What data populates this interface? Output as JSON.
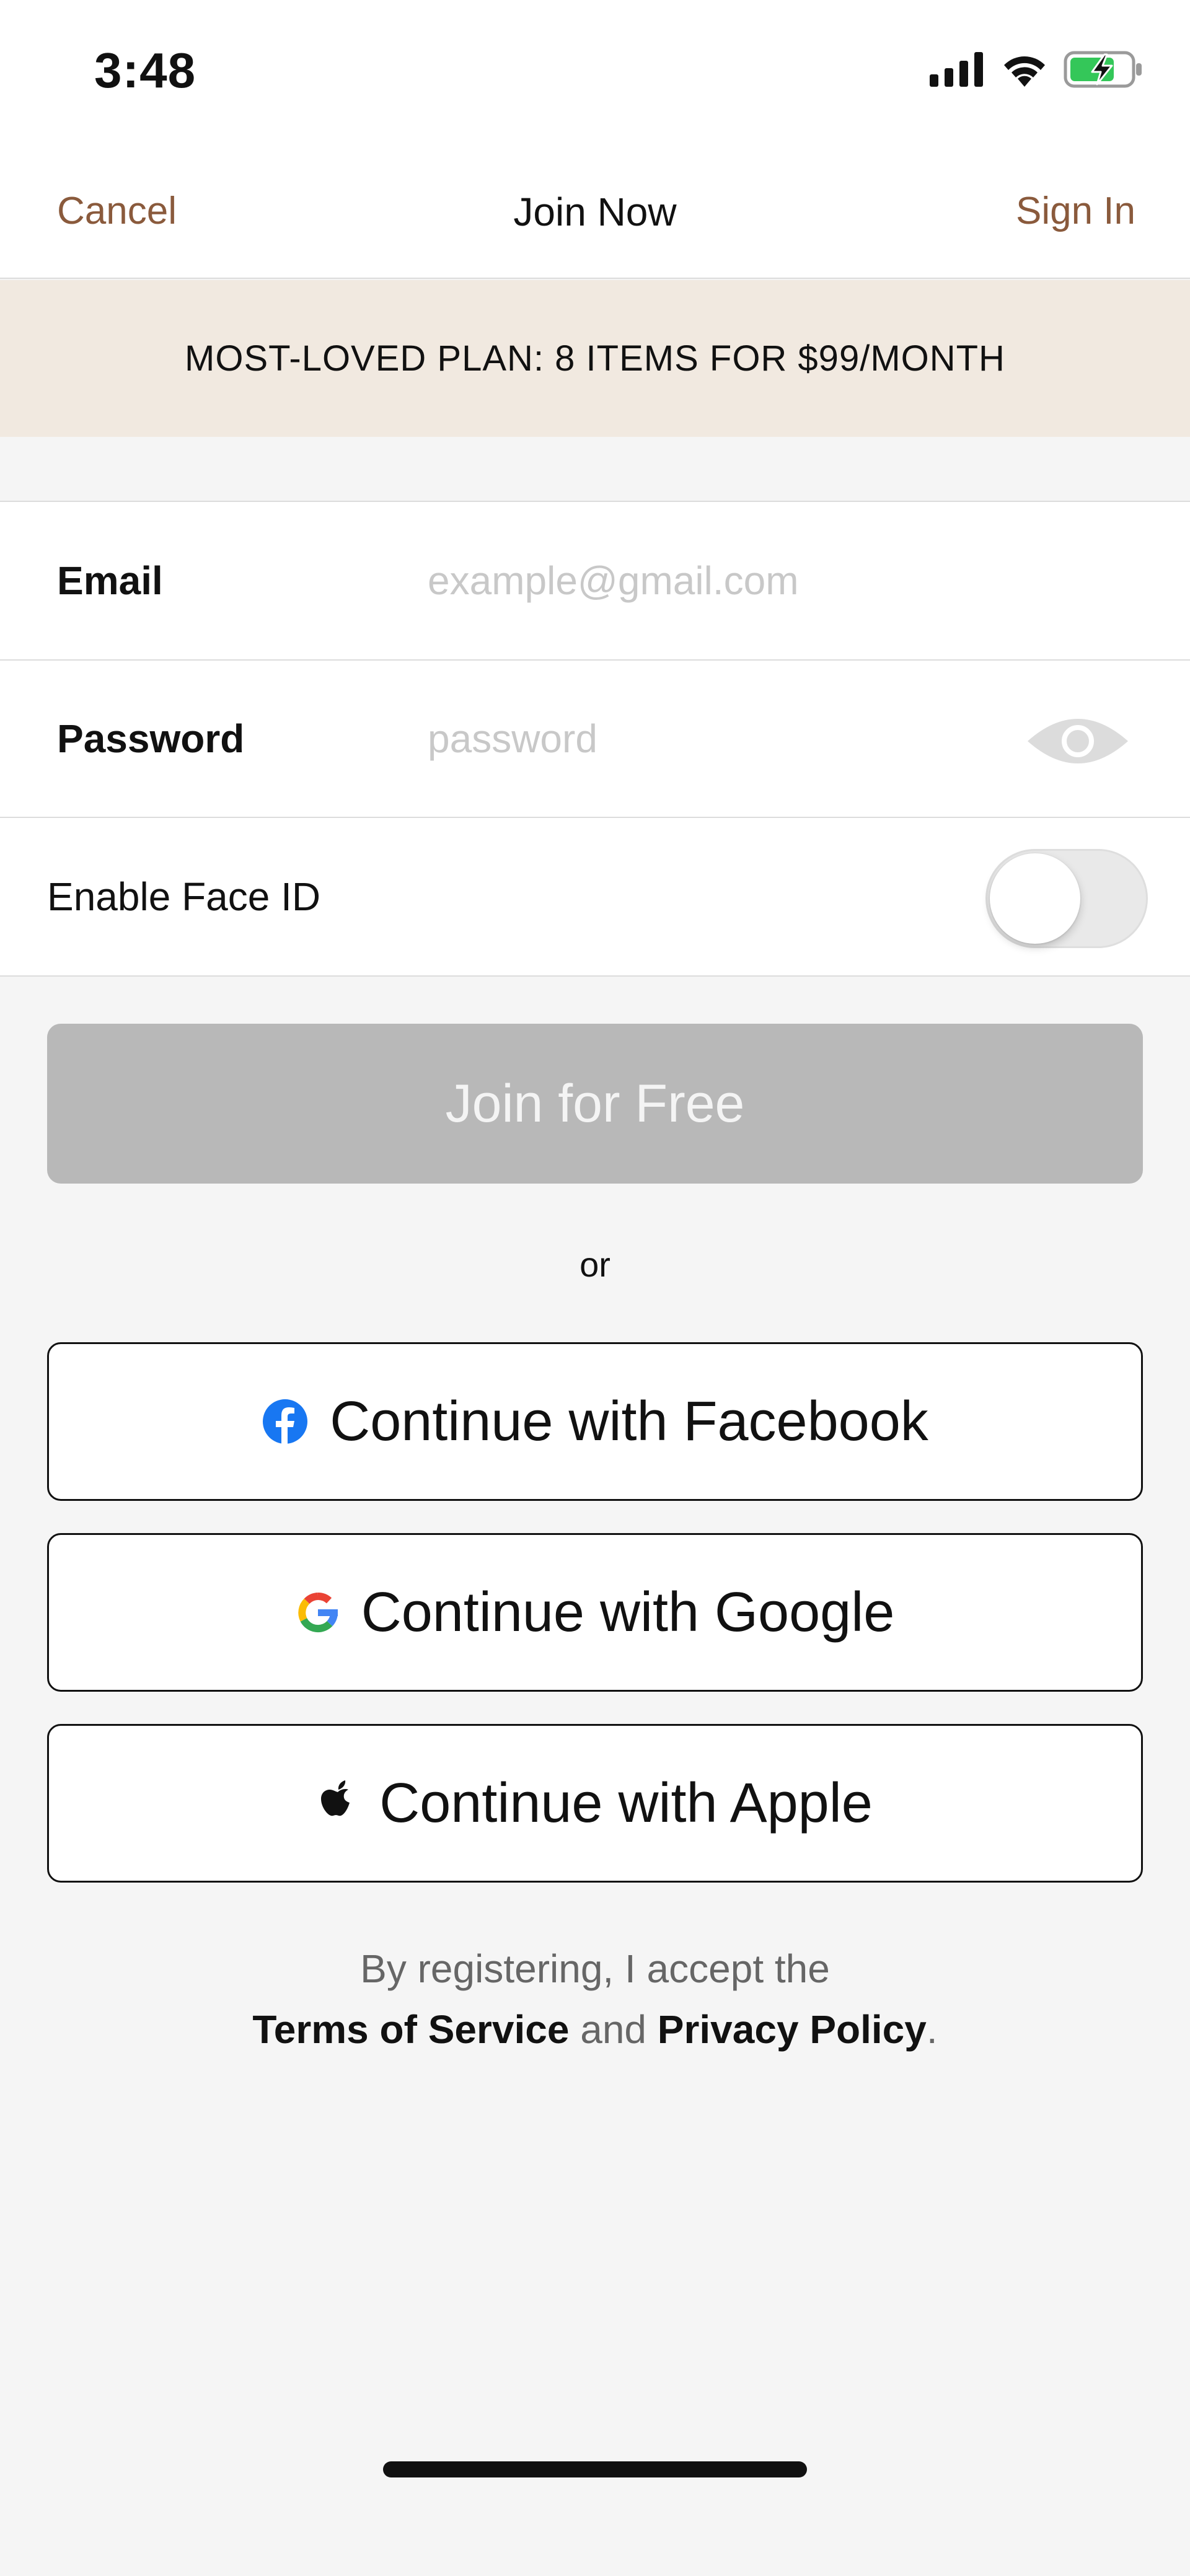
{
  "status_bar": {
    "time": "3:48",
    "icons": [
      "signal-icon",
      "wifi-icon",
      "battery-charging-icon"
    ]
  },
  "nav": {
    "cancel_label": "Cancel",
    "title": "Join Now",
    "signin_label": "Sign In"
  },
  "banner": {
    "text": "MOST-LOVED PLAN: 8 ITEMS FOR $99/MONTH"
  },
  "form": {
    "email_label": "Email",
    "email_placeholder": "example@gmail.com",
    "email_value": "",
    "password_label": "Password",
    "password_placeholder": "password",
    "password_value": "",
    "faceid_label": "Enable Face ID",
    "faceid_enabled": false
  },
  "actions": {
    "join_label": "Join for Free",
    "or_label": "or",
    "facebook_label": "Continue with Facebook",
    "google_label": "Continue with Google",
    "apple_label": "Continue with Apple"
  },
  "legal": {
    "prefix": "By registering, I accept the",
    "terms_label": "Terms of Service",
    "and_label": "and",
    "privacy_label": "Privacy Policy",
    "suffix": "."
  },
  "colors": {
    "accent_brown": "#8a5a3c",
    "banner_bg": "#f1e9e0",
    "disabled_button": "#b8b8b8",
    "facebook_blue": "#1877f2"
  }
}
